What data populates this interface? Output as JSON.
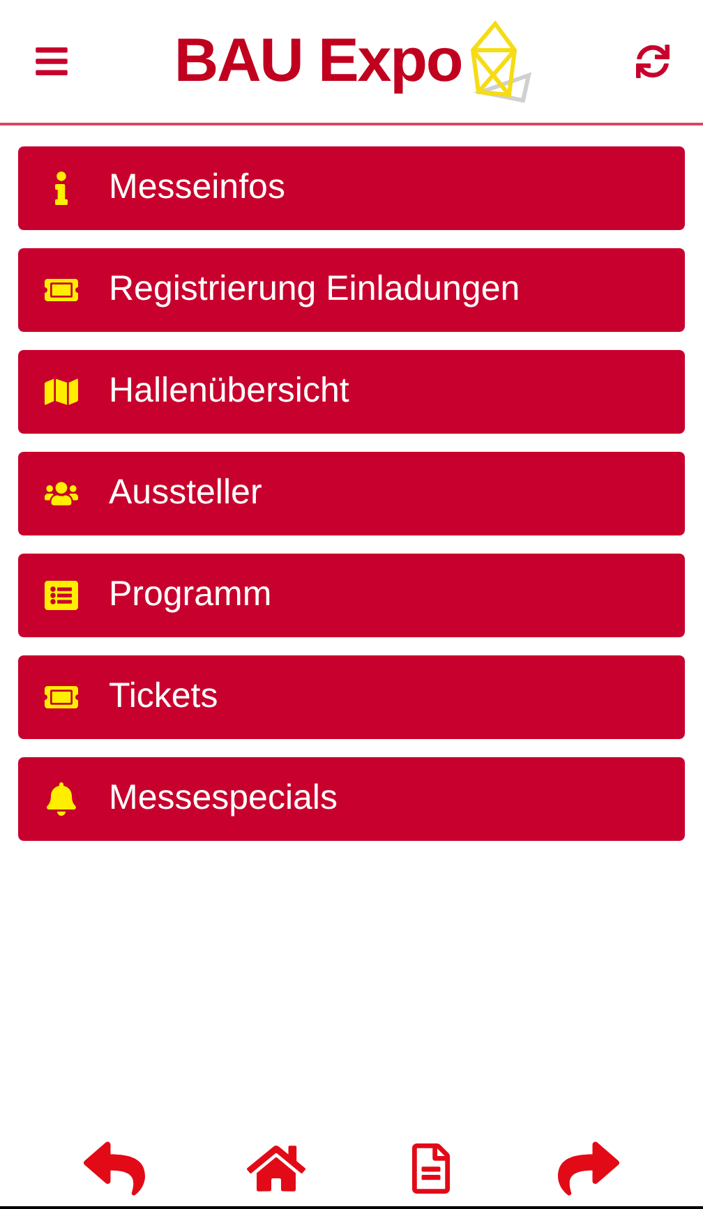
{
  "header": {
    "logo": "BAU Expo"
  },
  "menu": [
    {
      "label": "Messeinfos",
      "kind": "info"
    },
    {
      "label": "Registrierung Einladungen",
      "kind": "ticket"
    },
    {
      "label": "Hallenübersicht",
      "kind": "map"
    },
    {
      "label": "Aussteller",
      "kind": "people"
    },
    {
      "label": "Programm",
      "kind": "list"
    },
    {
      "label": "Tickets",
      "kind": "ticket"
    },
    {
      "label": "Messespecials",
      "kind": "bell"
    }
  ]
}
